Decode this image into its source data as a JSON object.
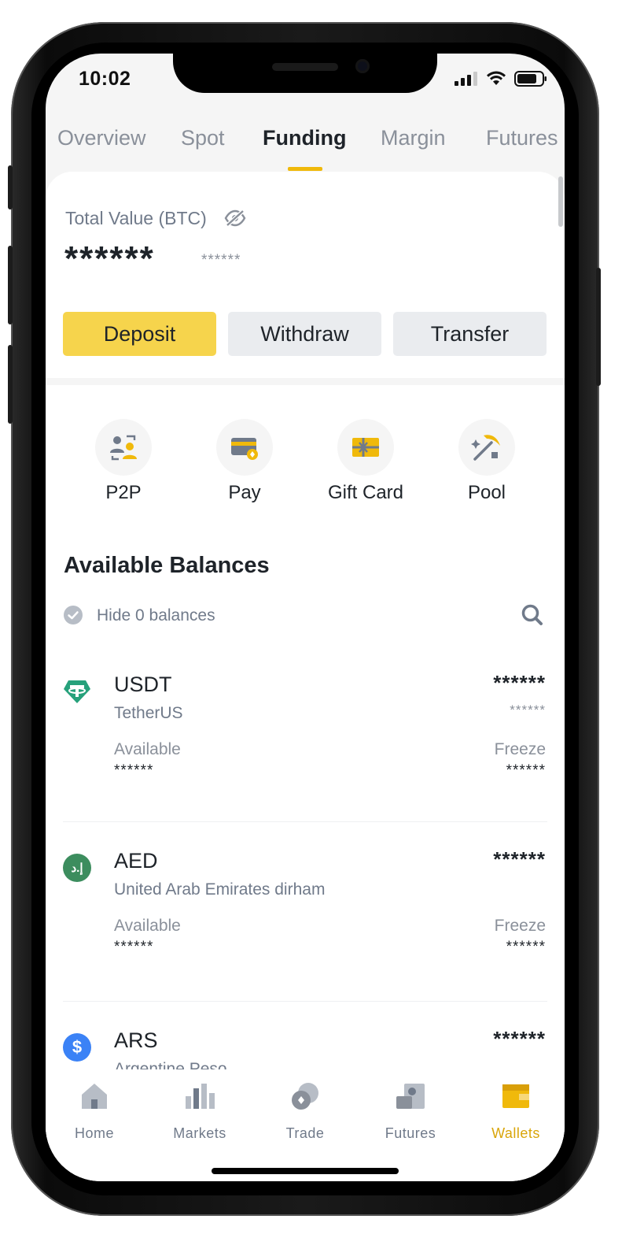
{
  "status_bar": {
    "time": "10:02"
  },
  "tabs": [
    {
      "label": "Overview",
      "active": false
    },
    {
      "label": "Spot",
      "active": false
    },
    {
      "label": "Funding",
      "active": true
    },
    {
      "label": "Margin",
      "active": false
    },
    {
      "label": "Futures",
      "active": false
    }
  ],
  "summary": {
    "total_label": "Total Value (BTC)",
    "total_value": "******",
    "total_sub_value": "******"
  },
  "actions": {
    "deposit": "Deposit",
    "withdraw": "Withdraw",
    "transfer": "Transfer"
  },
  "quick_links": [
    {
      "label": "P2P",
      "icon": "p2p-icon"
    },
    {
      "label": "Pay",
      "icon": "pay-card-icon"
    },
    {
      "label": "Gift Card",
      "icon": "gift-card-icon"
    },
    {
      "label": "Pool",
      "icon": "pickaxe-icon"
    }
  ],
  "balances": {
    "title": "Available Balances",
    "hide_label": "Hide 0 balances",
    "available_label": "Available",
    "freeze_label": "Freeze",
    "assets": [
      {
        "symbol": "USDT",
        "name": "TetherUS",
        "amount": "******",
        "amount_sub": "******",
        "available": "******",
        "freeze": "******",
        "logo_color": "#26a17b",
        "logo": "tether-logo"
      },
      {
        "symbol": "AED",
        "name": "United Arab Emirates dirham",
        "amount": "******",
        "available": "******",
        "freeze": "******",
        "logo_color": "#3c8d5e",
        "logo": "aed-logo",
        "logo_text": "إ.د"
      },
      {
        "symbol": "ARS",
        "name": "Argentine Peso",
        "amount": "******",
        "logo_color": "#3b82f6",
        "logo": "dollar-logo",
        "logo_text": "$"
      }
    ]
  },
  "bottom_nav": [
    {
      "label": "Home",
      "icon": "home-icon",
      "active": false
    },
    {
      "label": "Markets",
      "icon": "bar-chart-icon",
      "active": false
    },
    {
      "label": "Trade",
      "icon": "trade-icon",
      "active": false
    },
    {
      "label": "Futures",
      "icon": "futures-icon",
      "active": false
    },
    {
      "label": "Wallets",
      "icon": "wallet-icon",
      "active": true
    }
  ],
  "colors": {
    "accent": "#f0b90b",
    "deposit_button": "#f6d44c",
    "secondary_button": "#eaecef",
    "text_primary": "#1e2329",
    "text_secondary": "#707a8a",
    "active_nav": "#d9a50a"
  }
}
